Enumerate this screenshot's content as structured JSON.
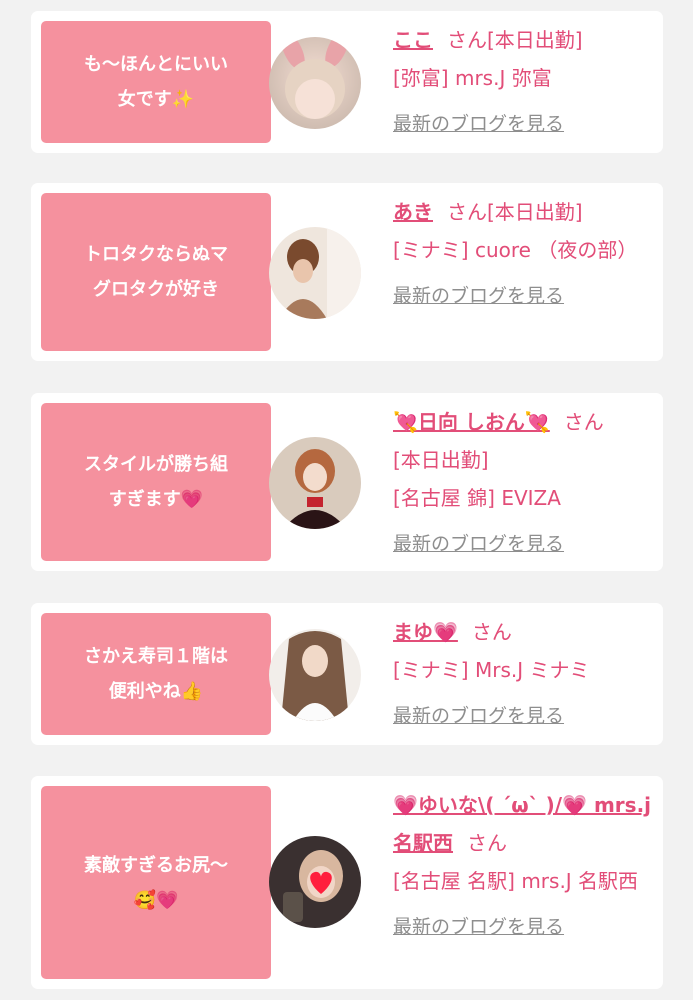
{
  "accent": "#e24d78",
  "bubble_color": "#f5919e",
  "cards": [
    {
      "comment": [
        "も〜ほんとにいい",
        "女です✨"
      ],
      "avatar_icon": "blonde-girl-bunny-ears",
      "name": "ここ",
      "san": "さん",
      "status": "[本日出勤]",
      "shop": "[弥富] mrs.J 弥富",
      "blog": "最新のブログを見る"
    },
    {
      "comment": [
        "トロタクならぬマ",
        "グロタクが好き"
      ],
      "avatar_icon": "girl-hair-updo",
      "name": "あき",
      "san": "さん",
      "status": "[本日出勤]",
      "shop": "[ミナミ] cuore （夜の部）",
      "blog": "最新のブログを見る"
    },
    {
      "comment": [
        "スタイルが勝ち組",
        "すぎます💗"
      ],
      "avatar_icon": "girl-red-top",
      "name": "💘日向 しおん💘",
      "san": "さん",
      "status": "[本日出勤]",
      "shop": "[名古屋 錦] EVIZA",
      "blog": "最新のブログを見る"
    },
    {
      "comment": [
        "さかえ寿司１階は",
        "便利やね👍"
      ],
      "avatar_icon": "girl-long-hair",
      "name": "まゆ💗",
      "san": "さん",
      "status": "",
      "shop": "[ミナミ] Mrs.J ミナミ",
      "blog": "最新のブログを見る"
    },
    {
      "comment": [
        "素敵すぎるお尻〜",
        "🥰💗"
      ],
      "avatar_icon": "girl-heart-covered",
      "name": "💗ゆいな\\( ´ω` )/💗 mrs.j名駅西",
      "san": "さん",
      "status": "",
      "shop": "[名古屋 名駅] mrs.J 名駅西",
      "blog": "最新のブログを見る"
    }
  ]
}
